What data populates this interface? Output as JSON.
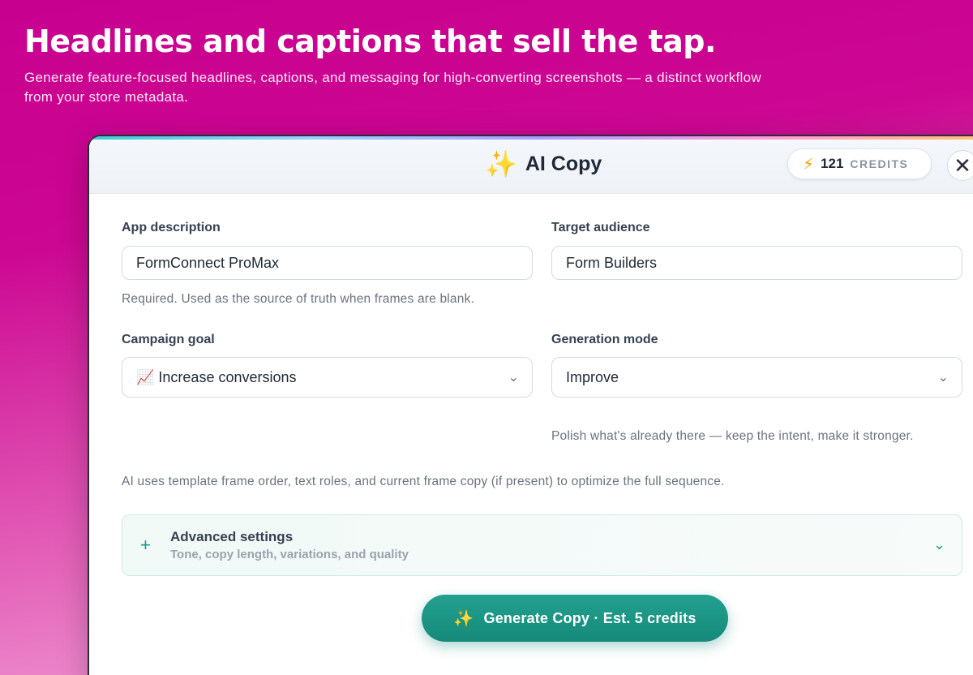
{
  "hero": {
    "headline": "Headlines and captions that sell the tap.",
    "subtitle": "Generate feature-focused headlines, captions, and messaging for high-converting screenshots — a distinct workflow from your store metadata."
  },
  "modal": {
    "title_icon": "✨",
    "title": "AI Copy",
    "credits_icon": "⚡",
    "credits_count": "121",
    "credits_label": "CREDITS",
    "close_glyph": "✕"
  },
  "form": {
    "app_description": {
      "label": "App description",
      "value": "FormConnect ProMax",
      "hint": "Required. Used as the source of truth when frames are blank."
    },
    "target_audience": {
      "label": "Target audience",
      "value": "Form Builders"
    },
    "campaign_goal": {
      "label": "Campaign goal",
      "value": "📈 Increase conversions"
    },
    "generation_mode": {
      "label": "Generation mode",
      "value": "Improve",
      "hint": "Polish what's already there — keep the intent, make it stronger."
    },
    "info_note": "AI uses template frame order, text roles, and current frame copy (if present) to optimize the full sequence."
  },
  "advanced": {
    "title": "Advanced settings",
    "subtitle": "Tone, copy length, variations, and quality"
  },
  "generate": {
    "icon": "✨",
    "label": "Generate Copy · Est. 5 credits"
  },
  "colors": {
    "accent_teal": "#1a9c8a",
    "background_magenta": "#c8008f"
  }
}
